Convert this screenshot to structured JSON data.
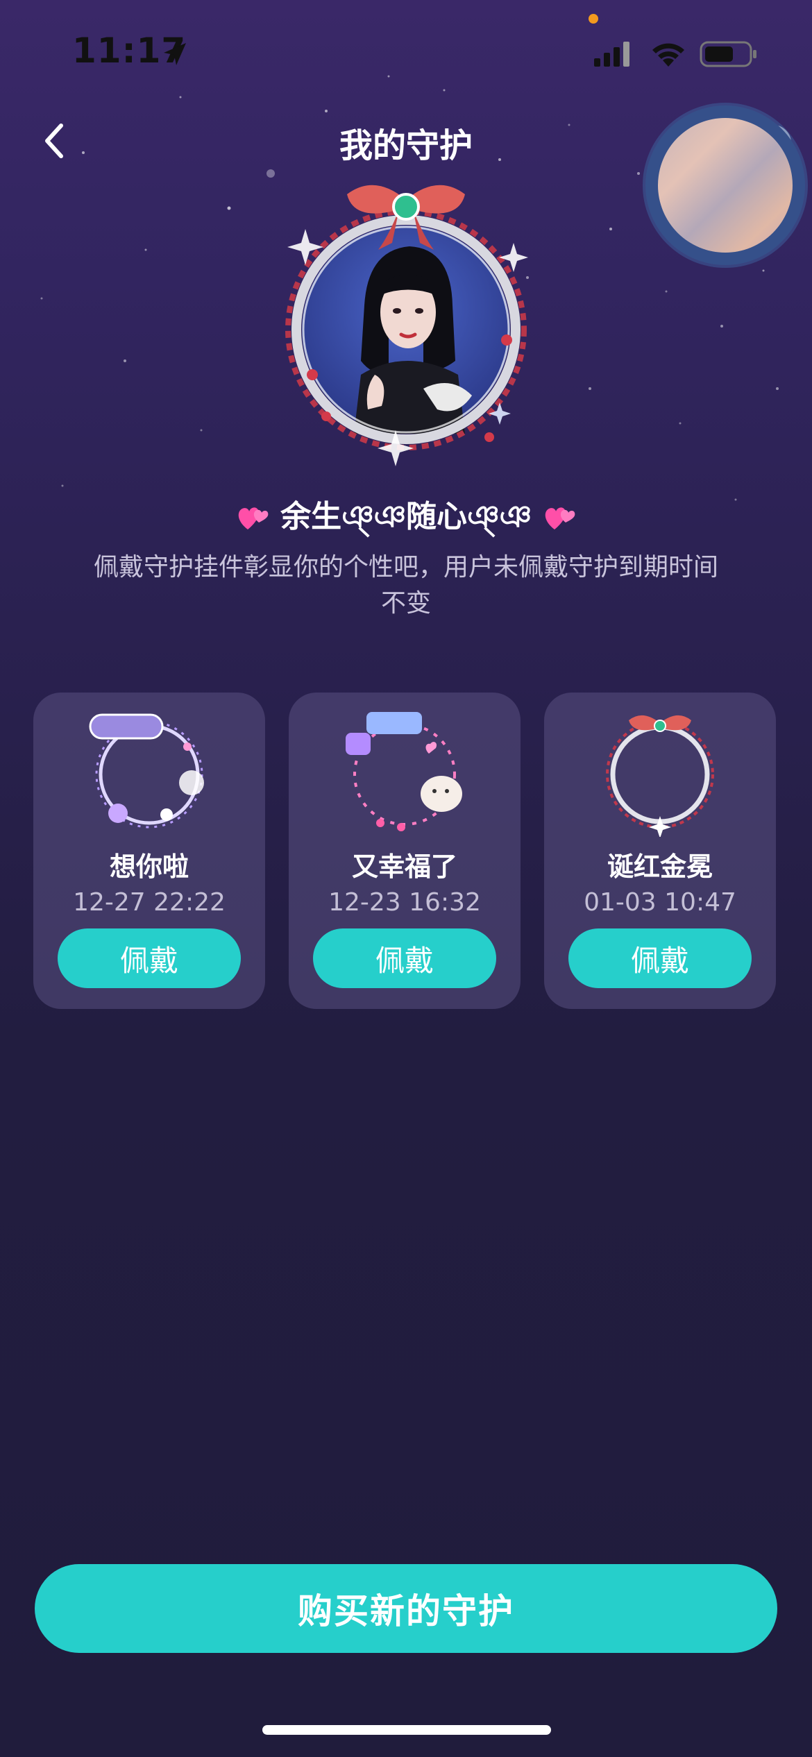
{
  "status_bar": {
    "time": "11:17",
    "icons": [
      "location-arrow-icon",
      "cellular-signal-icon",
      "wifi-icon",
      "battery-icon"
    ]
  },
  "header": {
    "title": "我的守护",
    "back_icon": "chevron-left-icon",
    "help_icon": "question-icon"
  },
  "profile": {
    "nickname": "余生ঞ্ঞ随心ঞ্ঞ",
    "description": "佩戴守护挂件彰显你的个性吧，用户未佩戴守护到期时间不变"
  },
  "guards": [
    {
      "name": "想你啦",
      "expiry": "12-27 22:22",
      "action": "佩戴"
    },
    {
      "name": "又幸福了",
      "expiry": "12-23 16:32",
      "action": "佩戴"
    },
    {
      "name": "诞红金冕",
      "expiry": "01-03 10:47",
      "action": "佩戴"
    }
  ],
  "buy_button": "购买新的守护",
  "colors": {
    "accent": "#26cfcb",
    "background_top": "#3a2868",
    "background_bottom": "#201c3c",
    "card": "#4a4268"
  }
}
